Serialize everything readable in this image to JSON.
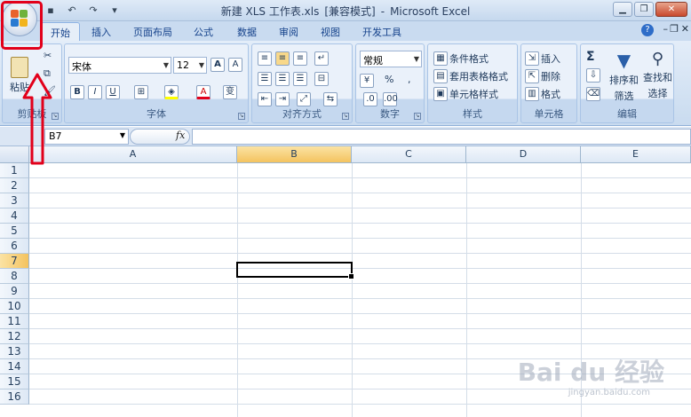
{
  "window": {
    "title_doc": "新建 XLS 工作表.xls",
    "title_mode": "[兼容模式]",
    "title_sep": "-",
    "title_app": "Microsoft Excel"
  },
  "tabs": [
    {
      "label": "开始",
      "active": true
    },
    {
      "label": "插入"
    },
    {
      "label": "页面布局"
    },
    {
      "label": "公式"
    },
    {
      "label": "数据"
    },
    {
      "label": "审阅"
    },
    {
      "label": "视图"
    },
    {
      "label": "开发工具"
    }
  ],
  "ribbon": {
    "clipboard": {
      "label": "剪贴板",
      "paste": "粘贴"
    },
    "font": {
      "label": "字体",
      "name": "宋体",
      "size": "12",
      "grow": "A",
      "shrink": "A",
      "bold": "B",
      "italic": "I",
      "underline": "U",
      "color": "A",
      "phonetic": "变"
    },
    "alignment": {
      "label": "对齐方式"
    },
    "number": {
      "label": "数字",
      "format": "常规",
      "percent": "%",
      "comma": ","
    },
    "styles": {
      "label": "样式",
      "cond": "条件格式",
      "table": "套用表格格式",
      "cell": "单元格样式"
    },
    "cells": {
      "label": "单元格",
      "insert": "插入",
      "delete": "删除",
      "format": "格式"
    },
    "editing": {
      "label": "编辑",
      "sort1": "排序和",
      "sort2": "筛选",
      "find1": "查找和",
      "find2": "选择",
      "sigma": "Σ"
    }
  },
  "formula_bar": {
    "name_box": "B7",
    "fx": "fx",
    "value": ""
  },
  "grid": {
    "columns": [
      "A",
      "B",
      "C",
      "D",
      "E"
    ],
    "rows": [
      "1",
      "2",
      "3",
      "4",
      "5",
      "6",
      "7",
      "8",
      "9",
      "10",
      "11",
      "12",
      "13",
      "14",
      "15",
      "16"
    ],
    "active_cell": "B7",
    "active_col": "B",
    "active_row": "7"
  },
  "watermark": {
    "main": "Bai du 经验",
    "sub": "jingyan.baidu.com"
  },
  "colors": {
    "annotation": "#e2001a",
    "selection_header": "#f4c35f"
  }
}
